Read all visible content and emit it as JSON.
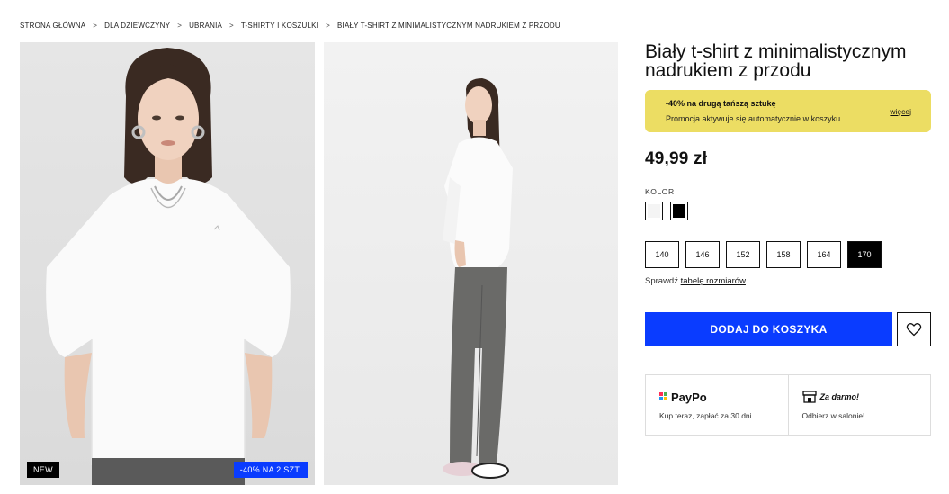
{
  "breadcrumb": {
    "items": [
      "STRONA GŁÓWNA",
      "DLA DZIEWCZYNY",
      "UBRANIA",
      "T-SHIRTY I KOSZULKI",
      "BIAŁY T-SHIRT Z MINIMALISTYCZNYM NADRUKIEM Z PRZODU"
    ],
    "separator": ">"
  },
  "gallery": {
    "badges": {
      "new": "NEW",
      "promo": "-40% NA 2 SZT."
    }
  },
  "product": {
    "title": "Biały t-shirt z minimalistycznym nadrukiem z przodu",
    "price": "49,99 zł"
  },
  "promo": {
    "title": "-40% na drugą tańszą sztukę",
    "text": "Promocja aktywuje się automatycznie w koszyku",
    "more": "więcej",
    "bg_color": "#ecdd63"
  },
  "color": {
    "label": "KOLOR",
    "options": [
      {
        "name": "white",
        "hex": "#f4f4f4"
      },
      {
        "name": "black",
        "hex": "#000000"
      }
    ]
  },
  "sizes": {
    "options": [
      "140",
      "146",
      "152",
      "158",
      "164",
      "170"
    ],
    "selected": "170"
  },
  "size_chart": {
    "prefix": "Sprawdź",
    "link": "tabelę rozmiarów"
  },
  "cart": {
    "add_label": "DODAJ DO KOSZYKA",
    "accent": "#0a3cff"
  },
  "benefits": [
    {
      "name": "PayPo",
      "icon": "paypo-logo-icon",
      "text": "Kup teraz, zapłać za 30 dni"
    },
    {
      "name": "Za darmo!",
      "icon": "store-icon",
      "text": "Odbierz w salonie!"
    }
  ]
}
